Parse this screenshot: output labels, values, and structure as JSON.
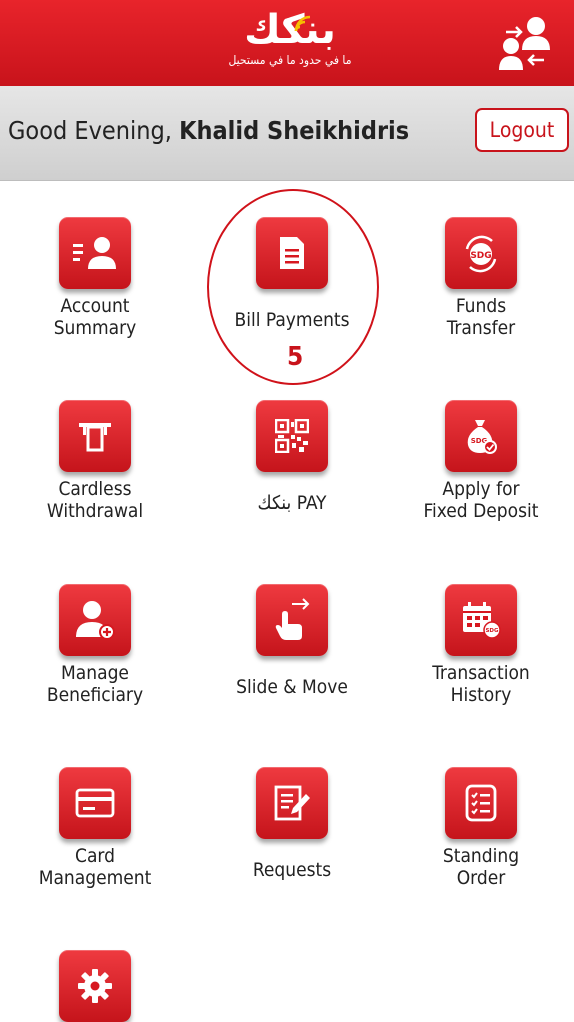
{
  "header": {
    "logo_text": "بنكك",
    "logo_tagline": "ما في حدود ما في مستحيل",
    "user_switch_icon": "switch-user-icon"
  },
  "greeting": {
    "prefix": "Good Evening, ",
    "name": "Khalid Sheikhidris",
    "logout_label": "Logout"
  },
  "menu": [
    {
      "line1": "Account",
      "line2": "Summary",
      "icon": "account-summary-icon"
    },
    {
      "line1": "Bill Payments",
      "line2": "",
      "icon": "bill-document-icon"
    },
    {
      "line1": "Funds",
      "line2": "Transfer",
      "icon": "sdg-transfer-icon"
    },
    {
      "line1": "Cardless",
      "line2": "Withdrawal",
      "icon": "atm-icon"
    },
    {
      "line1": "بنكك PAY",
      "line2": "",
      "icon": "qr-code-icon"
    },
    {
      "line1": "Apply for",
      "line2": "Fixed Deposit",
      "icon": "money-bag-icon"
    },
    {
      "line1": "Manage",
      "line2": "Beneficiary",
      "icon": "add-user-icon"
    },
    {
      "line1": "Slide & Move",
      "line2": "",
      "icon": "swipe-hand-icon"
    },
    {
      "line1": "Transaction",
      "line2": "History",
      "icon": "calendar-icon"
    },
    {
      "line1": "Card",
      "line2": "Management",
      "icon": "credit-card-icon"
    },
    {
      "line1": "Requests",
      "line2": "",
      "icon": "request-edit-icon"
    },
    {
      "line1": "Standing",
      "line2": "Order",
      "icon": "checklist-icon"
    },
    {
      "line1": "",
      "line2": "",
      "icon": "settings-gear-icon"
    }
  ],
  "annotation": {
    "number": "5"
  },
  "colors": {
    "brand_red": "#d7171f",
    "greet_bar": "#d9d9d9"
  }
}
